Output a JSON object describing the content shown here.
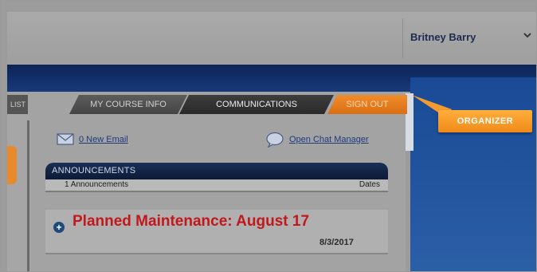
{
  "header": {
    "user_name": "Britney Barry",
    "user_menu_icon": "chevron-down-icon"
  },
  "tabs": [
    {
      "label": "LIST"
    },
    {
      "label": "MY COURSE INFO"
    },
    {
      "label": "COMMUNICATIONS"
    },
    {
      "label": "SIGN OUT"
    }
  ],
  "links": {
    "email": "0 New Email",
    "chat": "Open Chat Manager"
  },
  "announcements": {
    "heading": "ANNOUNCEMENTS",
    "count_text": "1 Announcements",
    "dates_label": "Dates",
    "items": [
      {
        "title": "Planned Maintenance: August 17",
        "date": "8/3/2017"
      }
    ]
  },
  "organizer": {
    "label": "ORGANIZER"
  },
  "colors": {
    "accent_orange": "#f08a1a",
    "navy": "#0d2356",
    "alert_red": "#c2181c"
  }
}
